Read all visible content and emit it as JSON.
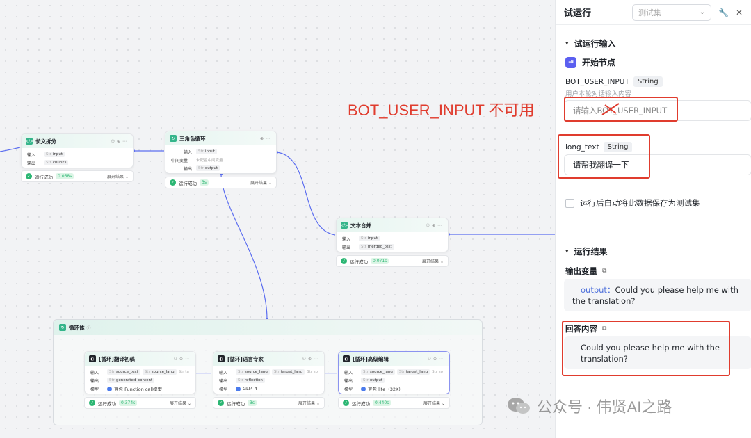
{
  "canvas": {
    "nodes": {
      "split": {
        "title": "长文拆分",
        "in_label": "输入",
        "in_value": "input",
        "out_label": "输出",
        "out_value": "chunks",
        "status": "运行成功",
        "time": "0.068s",
        "expand": "展开结果"
      },
      "loop3": {
        "title": "三角色循环",
        "in_label": "输入",
        "in_value": "input",
        "mid_label": "中间变量",
        "mid_value": "未配置中间变量",
        "out_label": "输出",
        "out_value": "output",
        "status": "运行成功",
        "time": "3s",
        "expand": "展开结果"
      },
      "merge": {
        "title": "文本合并",
        "in_label": "输入",
        "in_value": "input",
        "out_label": "输出",
        "out_value": "merged_text",
        "status": "运行成功",
        "time": "0.071s",
        "expand": "展开结果"
      },
      "loopbody": {
        "title": "循环体"
      },
      "translate": {
        "title": "[循环]翻译初稿",
        "in_label": "输入",
        "in_a": "source_text",
        "in_b": "source_lang",
        "in_c": "ta",
        "out_label": "输出",
        "out_value": "generated_content",
        "model_label": "模型",
        "model": "豆包·Function call模型",
        "status": "运行成功",
        "time": "0.374s",
        "expand": "展开结果"
      },
      "expert": {
        "title": "[循环]语言专家",
        "in_label": "输入",
        "in_a": "source_lang",
        "in_b": "target_lang",
        "in_c": "so",
        "out_label": "输出",
        "out_value": "reflection",
        "model_label": "模型",
        "model": "GLM-4",
        "status": "运行成功",
        "time": "3s",
        "expand": "展开结果"
      },
      "editor": {
        "title": "[循环]高级编辑",
        "in_label": "输入",
        "in_a": "source_lang",
        "in_b": "target_lang",
        "in_c": "so",
        "out_label": "输出",
        "out_value": "output",
        "model_label": "模型",
        "model": "豆包·lite（32K）",
        "status": "运行成功",
        "time": "0.440s",
        "expand": "展开结果"
      }
    },
    "type_prefix": "Str",
    "annotation": "BOT_USER_INPUT 不可用",
    "watermark": "公众号 · 伟贤AI之路"
  },
  "panel": {
    "title": "试运行",
    "select_placeholder": "测试集",
    "input_section": "试运行输入",
    "start_node": "开始节点",
    "var1": {
      "name": "BOT_USER_INPUT",
      "type": "String",
      "hint": "用户本轮对话输入内容",
      "placeholder": "请输入BOT_USER_INPUT"
    },
    "var2": {
      "name": "long_text",
      "type": "String",
      "value": "请帮我翻译一下"
    },
    "checkbox_label": "运行后自动将此数据保存为测试集",
    "result_section": "运行结果",
    "output_vars_label": "输出变量",
    "output_key": "output",
    "output_sep": "：",
    "output_value": "Could you please help me with the translation?",
    "answer_label": "回答内容",
    "answer_value": "Could you please help me with the translation?"
  },
  "colors": {
    "accent": "#4c6fdb",
    "success": "#2bb673",
    "annotation": "#e03c2e",
    "edge": "#5c6ef0"
  }
}
